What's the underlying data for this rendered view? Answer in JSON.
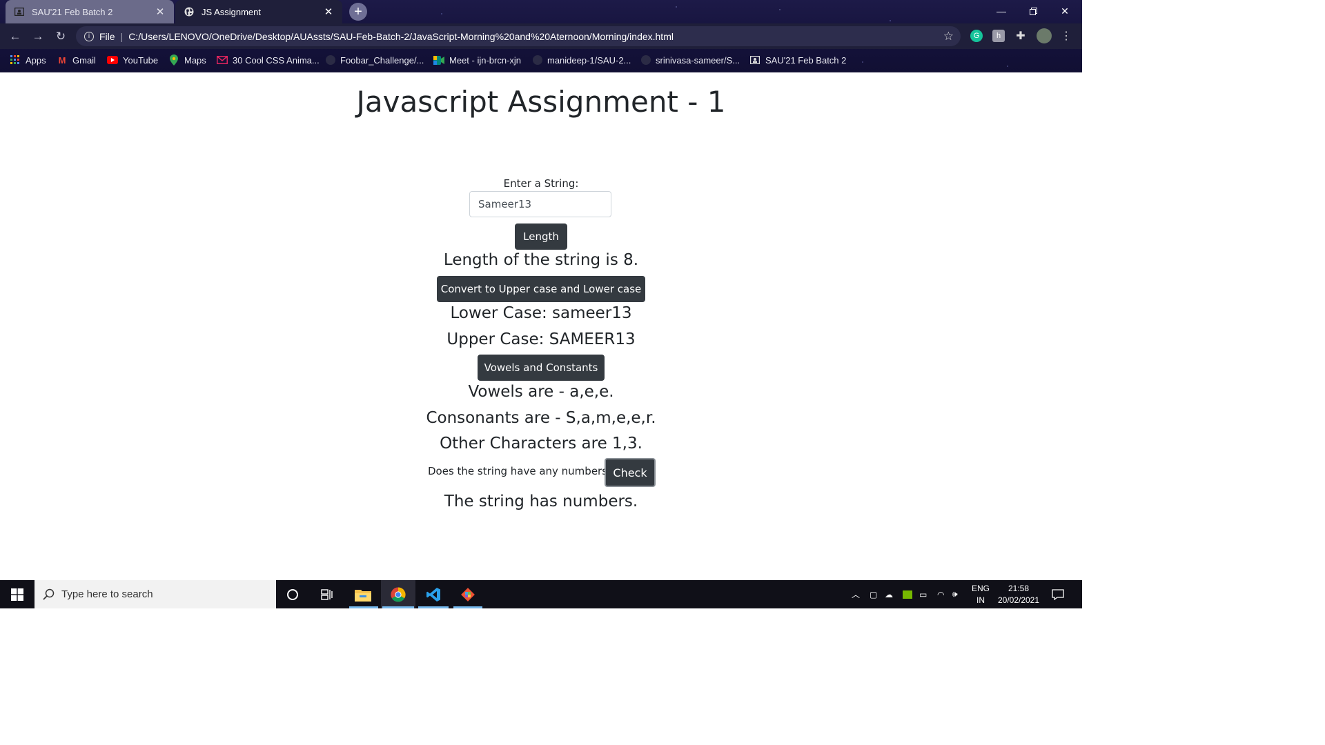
{
  "browser": {
    "tabs": [
      {
        "title": "SAU'21 Feb Batch 2",
        "active": false
      },
      {
        "title": "JS Assignment",
        "active": true
      }
    ],
    "new_tab_glyph": "+",
    "address": {
      "scheme": "File",
      "url": "C:/Users/LENOVO/OneDrive/Desktop/AUAssts/SAU-Feb-Batch-2/JavaScript-Morning%20and%20Aternoon/Morning/index.html"
    },
    "bookmarks": [
      {
        "label": "Apps",
        "icon": "apps-grid-icon"
      },
      {
        "label": "Gmail",
        "icon": "gmail-icon"
      },
      {
        "label": "YouTube",
        "icon": "youtube-icon"
      },
      {
        "label": "Maps",
        "icon": "maps-pin-icon"
      },
      {
        "label": "30 Cool CSS Anima...",
        "icon": "mail-icon"
      },
      {
        "label": "Foobar_Challenge/...",
        "icon": "github-icon"
      },
      {
        "label": "Meet - ijn-brcn-xjn",
        "icon": "meet-icon"
      },
      {
        "label": "manideep-1/SAU-2...",
        "icon": "github-icon"
      },
      {
        "label": "srinivasa-sameer/S...",
        "icon": "github-icon"
      },
      {
        "label": "SAU'21 Feb Batch 2",
        "icon": "classroom-icon"
      }
    ],
    "extension_letters": {
      "grammarly": "G",
      "ext2": "h"
    }
  },
  "page": {
    "title": "Javascript Assignment - 1",
    "input_label": "Enter a String:",
    "input_value": "Sameer13",
    "length_button": "Length",
    "length_result": "Length of the string is 8.",
    "case_button": "Convert to Upper case and Lower case",
    "lower_result": "Lower Case: sameer13",
    "upper_result": "Upper Case: SAMEER13",
    "vowels_button": "Vowels and Constants",
    "vowels_result": "Vowels are - a,e,e.",
    "consonants_result": "Consonants are - S,a,m,e,e,r.",
    "other_result": "Other Characters are 1,3.",
    "numbers_question": "Does the string have any numbers?",
    "check_button": "Check",
    "numbers_result": "The string has numbers."
  },
  "taskbar": {
    "search_placeholder": "Type here to search",
    "language": "ENG",
    "region": "IN",
    "time": "21:58",
    "date": "20/02/2021"
  },
  "colors": {
    "button_dark": "#343a40",
    "text": "#212529",
    "taskbar_accent": "#76b9ed"
  }
}
